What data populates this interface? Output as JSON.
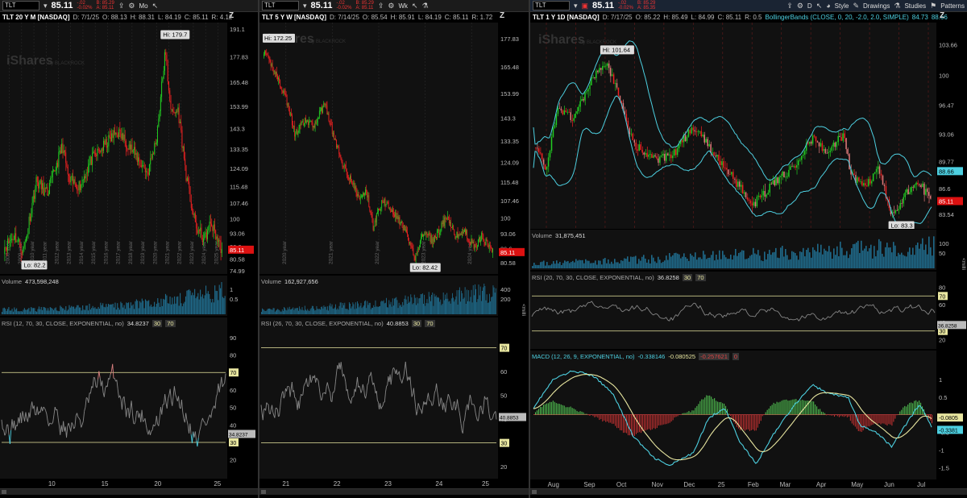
{
  "panels": [
    {
      "id": "p1",
      "symbol_input": "TLT",
      "price": "85.11",
      "change": "-.02",
      "change_pct": "-0.02%",
      "bid": "B: 85.29",
      "ask": "A: 85.11",
      "timeframe_btn": "Mo",
      "title": "TLT 20 Y M [NASDAQ]",
      "ohlc": [
        "D: 7/1/25",
        "O: 88.13",
        "H: 88.31",
        "L: 84.19",
        "C: 85.11",
        "R: 4.12"
      ],
      "volume_label": "Volume",
      "volume_value": "473,598,248",
      "rsi_label": "RSI (12, 70, 30, CLOSE, EXPONENTIAL, no)",
      "rsi_value": "34.8237",
      "rsi_ob": "30",
      "rsi_os": "70",
      "hi_label": "Hi: 179.7",
      "lo_label": "Lo: 82.2",
      "last_price_tag": "85.11",
      "rsi_tag": "34.8237",
      "price_axis": [
        "191.1",
        "177.83",
        "165.48",
        "153.99",
        "143.3",
        "133.35",
        "124.09",
        "115.48",
        "107.46",
        "100",
        "93.06",
        "86.6",
        "80.58",
        "74.99"
      ],
      "vol_axis": [
        "1",
        "0.5"
      ],
      "rsi_axis": [
        "90",
        "80",
        "70",
        "60",
        "50",
        "40",
        "30",
        "20"
      ],
      "x_axis": [
        "10",
        "15",
        "20",
        "25"
      ],
      "year_labels": [
        "2008 year",
        "2009 year",
        "2010 year",
        "2011 year",
        "2012 year",
        "2013 year",
        "2014 year",
        "2015 year",
        "2016 year",
        "2017 year",
        "2018 year",
        "2019 year",
        "2020 year",
        "2021 year",
        "2022 year",
        "2023 year",
        "2024 year",
        "2025 year"
      ]
    },
    {
      "id": "p2",
      "symbol_input": "TLT",
      "price": "85.11",
      "change": "-.02",
      "change_pct": "-0.02%",
      "bid": "B: 85.29",
      "ask": "A: 85.11",
      "timeframe_btn": "Wk",
      "title": "TLT 5 Y W [NASDAQ]",
      "ohlc": [
        "D: 7/14/25",
        "O: 85.54",
        "H: 85.91",
        "L: 84.19",
        "C: 85.11",
        "R: 1.72"
      ],
      "volume_label": "Volume",
      "volume_value": "162,927,656",
      "rsi_label": "RSI (26, 70, 30, CLOSE, EXPONENTIAL, no)",
      "rsi_value": "40.8853",
      "rsi_ob": "30",
      "rsi_os": "70",
      "hi_label": "Hi: 172.25",
      "lo_label": "Lo: 82.42",
      "last_price_tag": "85.11",
      "rsi_tag": "40.8853",
      "price_axis": [
        "177.83",
        "165.48",
        "153.99",
        "143.3",
        "133.35",
        "124.09",
        "115.48",
        "107.46",
        "100",
        "93.06",
        "86.6",
        "80.58"
      ],
      "vol_axis": [
        "400",
        "200"
      ],
      "vol_unit": "<millions>",
      "rsi_axis": [
        "70",
        "60",
        "50",
        "40",
        "30",
        "20"
      ],
      "x_axis": [
        "21",
        "22",
        "23",
        "24",
        "25"
      ],
      "year_labels": [
        "2020 year",
        "2021 year",
        "2022 year",
        "2023 year",
        "2024 year"
      ]
    },
    {
      "id": "p3",
      "symbol_input": "TLT",
      "price": "85.11",
      "change": "-.02",
      "change_pct": "-0.02%",
      "bid": "B: 85.29",
      "ask": "A: 85.35",
      "timeframe_btn": "D",
      "style_btn": "Style",
      "drawings_btn": "Drawings",
      "studies_btn": "Studies",
      "patterns_btn": "Patterns",
      "title": "TLT 1 Y 1D [NASDAQ]",
      "ohlc": [
        "D: 7/17/25",
        "O: 85.22",
        "H: 85.49",
        "L: 84.99",
        "C: 85.11",
        "R: 0.5"
      ],
      "bb_label": "BollingerBands (CLOSE, 0, 20, -2.0, 2.0, SIMPLE)",
      "bb_v1": "84.73",
      "bb_v2": "88.66",
      "volume_label": "Volume",
      "volume_value": "31,875,451",
      "vol_axis": [
        "100",
        "50"
      ],
      "vol_unit": "<millions>",
      "rsi_label": "RSI (20, 70, 30, CLOSE, EXPONENTIAL, no)",
      "rsi_value": "36.8258",
      "rsi_ob": "30",
      "rsi_os": "70",
      "rsi_tag": "36.8258",
      "rsi_axis": [
        "80",
        "70",
        "60",
        "40",
        "30",
        "20"
      ],
      "macd_label": "MACD (12, 26, 9, EXPONENTIAL, no)",
      "macd_v1": "-0.338146",
      "macd_v2": "-0.080525",
      "macd_v3": "-0.257621",
      "macd_v4": "0",
      "macd_tag1": "-0.0805",
      "macd_tag2": "-0.3381",
      "macd_axis": [
        "1",
        "0.5",
        "-0.5",
        "-1",
        "-1.5"
      ],
      "hi_label": "Hi: 101.64",
      "lo_label": "Lo: 83.3",
      "last_price_tag": "85.11",
      "bb_tag": "88.66",
      "price_axis": [
        "103.66",
        "100",
        "96.47",
        "93.06",
        "89.77",
        "86.6",
        "83.54"
      ],
      "x_axis": [
        "Aug",
        "Sep",
        "Oct",
        "Nov",
        "Dec",
        "25",
        "Feb",
        "Mar",
        "Apr",
        "May",
        "Jun",
        "Jul"
      ]
    }
  ],
  "colors": {
    "up": "#22cc22",
    "down": "#ee2222",
    "down_light": "#e07a7a",
    "rsi_line": "#888888",
    "rsi_ob_line": "#e8e6a0",
    "volume": "#1f6a8a",
    "bb": "#4dd0e1",
    "macd_line": "#4dd0e1",
    "macd_signal": "#e8e6a0",
    "price_tag": "#dd1111"
  }
}
